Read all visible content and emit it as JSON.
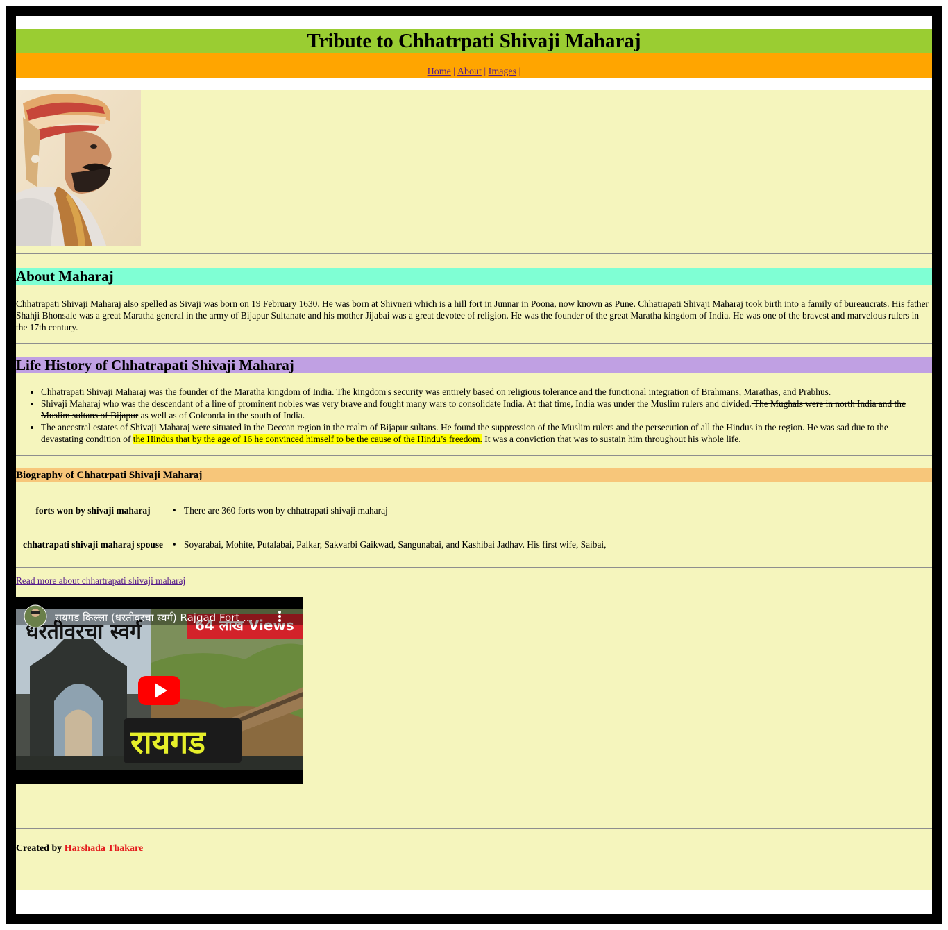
{
  "header": {
    "title": "Tribute to Chhatrpati Shivaji Maharaj"
  },
  "nav": {
    "items": [
      "Home",
      "About",
      "Images"
    ],
    "separator": "|"
  },
  "about": {
    "heading": "About Maharaj",
    "text": "Chhatrapati Shivaji Maharaj also spelled as Sivaji was born on 19 February 1630. He was born at Shivneri which is a hill fort in Junnar in Poona, now known as Pune. Chhatrapati Shivaji Maharaj took birth into a family of bureaucrats. His father Shahji Bhonsale was a great Maratha general in the army of Bijapur Sultanate and his mother Jijabai was a great devotee of religion. He was the founder of the great Maratha kingdom of India. He was one of the bravest and marvelous rulers in the 17th century."
  },
  "life": {
    "heading": "Life History of Chhatrapati Shivaji Maharaj",
    "item1": "Chhatrapati Shivaji Maharaj was the founder of the Maratha kingdom of India. The kingdom's security was entirely based on religious tolerance and the functional integration of Brahmans, Marathas, and Prabhus.",
    "item2_a": "Shivaji Maharaj who was the descendant of a line of prominent nobles was very brave and fought many wars to consolidate India. At that time, India was under the Muslim rulers and divided.",
    "item2_strike": " The Mughals were in north India and the Muslim sultans of Bijapur",
    "item2_b": " as well as of Golconda in the south of India.",
    "item3_a": "The ancestral estates of Shivaji Maharaj were situated in the Deccan region in the realm of Bijapur sultans. He found the suppression of the Muslim rulers and the persecution of all the Hindus in the region. He was sad due to the devastating condition of ",
    "item3_mark": "the Hindus that by the age of 16 he convinced himself to be the cause of the Hindu’s freedom.",
    "item3_b": " It was a conviction that was to sustain him throughout his whole life."
  },
  "bio": {
    "heading": "Biography of Chhatrpati Shivaji Maharaj",
    "rows": [
      {
        "key": "forts won by shivaji maharaj",
        "value": "There are 360 forts won by chhatrapati shivaji maharaj"
      },
      {
        "key": "chhatrapati shivaji maharaj spouse",
        "value": "Soyarabai, Mohite, Putalabai, Palkar, Sakvarbi Gaikwad, Sangunabai, and Kashibai Jadhav. His first wife, Saibai,"
      }
    ]
  },
  "readmore": "Read more about chhartrapati shivaji maharaj",
  "video": {
    "title": "रायगड किल्ला (धरतीवरचा स्वर्ग) Rajgad Fort ...",
    "overlay_top": "धरतीवरचा स्वर्ग",
    "views_badge": "64 लाख Views",
    "overlay_bottom": "रायगड"
  },
  "footer": {
    "prefix": "Created by",
    "author": "Harshada Thakare"
  },
  "colors": {
    "title_bg": "#9acd32",
    "nav_bg": "#ffa500",
    "content_bg": "#f5f5bd",
    "about_bg": "#7fffd4",
    "life_bg": "#c0a0e3",
    "bio_bg": "#f7c67a",
    "author": "#e41a1c"
  }
}
